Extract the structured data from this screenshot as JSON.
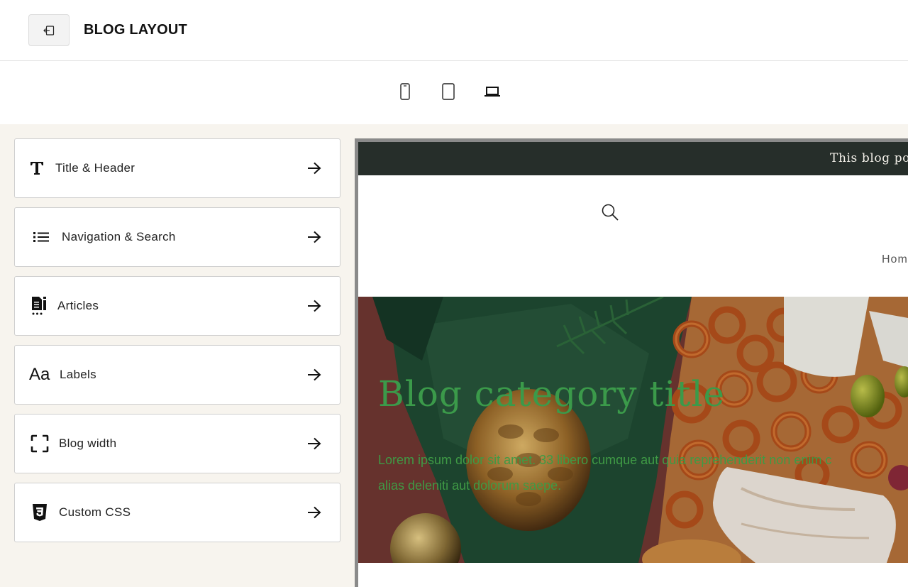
{
  "header": {
    "title": "BLOG LAYOUT",
    "back_icon": "exit-icon"
  },
  "devices": [
    {
      "name": "mobile",
      "icon": "mobile-icon"
    },
    {
      "name": "tablet",
      "icon": "tablet-icon"
    },
    {
      "name": "desktop",
      "icon": "laptop-icon"
    }
  ],
  "menu": [
    {
      "label": "Title & Header",
      "icon": "title-T-icon"
    },
    {
      "label": "Navigation & Search",
      "icon": "list-icon"
    },
    {
      "label": "Articles",
      "icon": "articles-icon"
    },
    {
      "label": "Labels",
      "icon": "font-Aa-icon"
    },
    {
      "label": "Blog width",
      "icon": "expand-frame-icon"
    },
    {
      "label": "Custom CSS",
      "icon": "css3-icon"
    }
  ],
  "preview": {
    "announcement": "This blog po",
    "nav_home": "Hom",
    "hero_title": "Blog category title",
    "hero_description_line1": "Lorem ipsum dolor sit amet. 33 libero cumque aut quia reprehenderit non enim c",
    "hero_description_line2": "alias deleniti aut dolorum saepe.",
    "colors": {
      "announce_bg": "#262e2a",
      "hero_text": "#3b9a4a",
      "workspace_bg": "#f7f4ee"
    }
  }
}
